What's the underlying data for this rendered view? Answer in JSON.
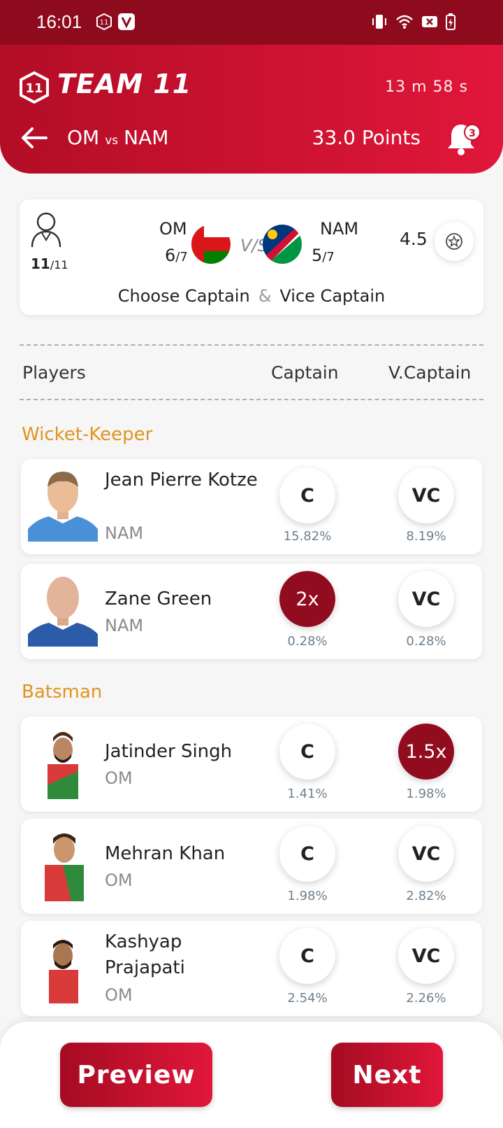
{
  "status_bar": {
    "time": "16:01"
  },
  "header": {
    "brand": "TEAM 11",
    "timer": "13 m 58 s",
    "team_a": "OM",
    "vs": "vs",
    "team_b": "NAM",
    "points": "33.0 Points",
    "notification_count": "3"
  },
  "summary": {
    "selected": "11",
    "total": "/11",
    "team_a": {
      "name": "OM",
      "count": "6",
      "max": "/7"
    },
    "vs_label": "V/S",
    "team_b": {
      "name": "NAM",
      "count": "5",
      "max": "/7"
    },
    "credit": "4.5",
    "choose_captain": "Choose Captain",
    "amp": "&",
    "vice_captain": "Vice Captain"
  },
  "columns": {
    "players": "Players",
    "captain": "Captain",
    "vice_captain": "V.Captain"
  },
  "sections": [
    {
      "title": "Wicket-Keeper",
      "players": [
        {
          "name": "Jean Pierre Kotze",
          "team": "NAM",
          "c_label": "C",
          "c_pct": "15.82%",
          "vc_label": "VC",
          "vc_pct": "8.19%"
        },
        {
          "name": "Zane Green",
          "team": "NAM",
          "c_label": "2x",
          "c_pct": "0.28%",
          "vc_label": "VC",
          "vc_pct": "0.28%"
        }
      ]
    },
    {
      "title": "Batsman",
      "players": [
        {
          "name": "Jatinder Singh",
          "team": "OM",
          "c_label": "C",
          "c_pct": "1.41%",
          "vc_label": "1.5x",
          "vc_pct": "1.98%"
        },
        {
          "name": "Mehran Khan",
          "team": "OM",
          "c_label": "C",
          "c_pct": "1.98%",
          "vc_label": "VC",
          "vc_pct": "2.82%"
        },
        {
          "name": "Kashyap Prajapati",
          "team": "OM",
          "c_label": "C",
          "c_pct": "2.54%",
          "vc_label": "VC",
          "vc_pct": "2.26%"
        }
      ]
    }
  ],
  "footer": {
    "preview": "Preview",
    "next": "Next"
  },
  "colors": {
    "primary": "#c8102e",
    "dark_red": "#920c1f",
    "section": "#e0941e"
  }
}
